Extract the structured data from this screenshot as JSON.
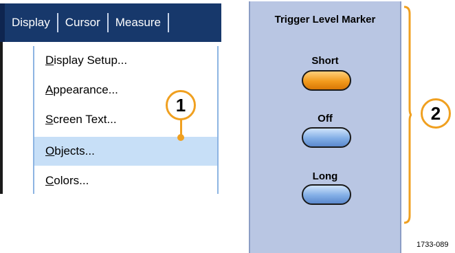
{
  "menubar": {
    "items": [
      {
        "label": "Display"
      },
      {
        "label": "Cursor"
      },
      {
        "label": "Measure"
      }
    ]
  },
  "dropdown": {
    "items": [
      {
        "mnemonic": "D",
        "rest": "isplay Setup...",
        "selected": false
      },
      {
        "mnemonic": "A",
        "rest": "ppearance...",
        "selected": false
      },
      {
        "mnemonic": "S",
        "rest": "creen Text...",
        "selected": false
      },
      {
        "mnemonic": "O",
        "rest": "bjects...",
        "selected": true
      },
      {
        "mnemonic": "C",
        "rest": "olors...",
        "selected": false
      }
    ]
  },
  "callouts": {
    "one": "1",
    "two": "2"
  },
  "panel": {
    "title": "Trigger Level Marker",
    "options": [
      {
        "label": "Short",
        "state": "selected"
      },
      {
        "label": "Off",
        "state": "unselected"
      },
      {
        "label": "Long",
        "state": "unselected"
      }
    ]
  },
  "figure_id": "1733-089",
  "colors": {
    "menubar": "#17386b",
    "selected_row": "#c7dff7",
    "callout": "#f0a020",
    "panel": "#b9c6e3",
    "button_on": "#f29a1c",
    "button_off": "#82aee6"
  }
}
